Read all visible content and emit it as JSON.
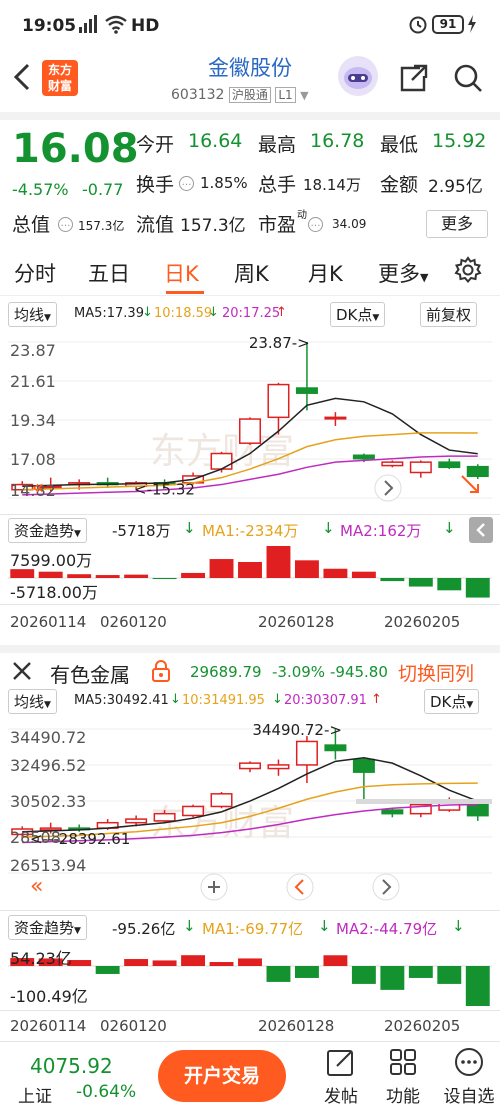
{
  "status": {
    "time": "19:05",
    "hd": "HD",
    "battery": "91"
  },
  "header": {
    "logo_line1": "东方",
    "logo_line2": "财富",
    "stock_name": "金徽股份",
    "stock_code": "603132",
    "tag1": "沪股通",
    "tag2": "L1"
  },
  "quote": {
    "price": "16.08",
    "change_pct": "-4.57%",
    "change": "-0.77",
    "open_label": "今开",
    "open": "16.64",
    "high_label": "最高",
    "high": "16.78",
    "low_label": "最低",
    "low": "15.92",
    "turnover_label": "换手",
    "turnover": "1.85%",
    "volume_label": "总手",
    "volume": "18.14万",
    "amount_label": "金额",
    "amount": "2.95亿",
    "mcap_label": "总值",
    "mcap": "157.3亿",
    "float_label": "流值",
    "float": "157.3亿",
    "pe_label": "市盈",
    "pe_sup": "动",
    "pe": "34.09",
    "more": "更多"
  },
  "tabs": {
    "t1": "分时",
    "t2": "五日",
    "t3": "日K",
    "t4": "周K",
    "t5": "月K",
    "t6": "更多"
  },
  "stock_chart": {
    "ma_select": "均线",
    "ma5": "MA5:17.39",
    "ma10": "10:18.59",
    "ma20": "20:17.25",
    "dk": "DK点",
    "fq": "前复权",
    "y_labels": [
      "23.87",
      "21.61",
      "19.34",
      "17.08",
      "14.82"
    ],
    "max_label": "23.87->",
    "min_label": "<-15.32",
    "fund_label": "资金趋势",
    "fund_value": "-5718万",
    "fund_ma1": "MA1:-2334万",
    "fund_ma2": "MA2:162万",
    "fund_top": "7599.00万",
    "fund_bottom": "-5718.00万",
    "dates": [
      "20260114",
      "0260120",
      "20260128",
      "20260205"
    ]
  },
  "sector": {
    "name": "有色金属",
    "value": "29689.79",
    "pct": "-3.09%",
    "chg": "-945.80",
    "switch": "切换同列",
    "ma_select": "均线",
    "ma5": "MA5:30492.41",
    "ma10": "10:31491.95",
    "ma20": "20:30307.91",
    "dk": "DK点",
    "y_labels": [
      "34490.72",
      "32496.52",
      "30502.33",
      "28508.",
      "26513.94"
    ],
    "max_label": "34490.72->",
    "min_label": "<---28392.61",
    "fund_label": "资金趋势",
    "fund_value": "-95.26亿",
    "fund_ma1": "MA1:-69.77亿",
    "fund_ma2": "MA2:-44.79亿",
    "fund_top": "54.23亿",
    "fund_bottom": "-100.49亿",
    "dates": [
      "20260114",
      "0260120",
      "20260128",
      "20260205"
    ]
  },
  "bottom": {
    "index_value": "4075.92",
    "index_name": "上证",
    "index_pct": "-0.64%",
    "trade": "开户交易",
    "post": "发帖",
    "func": "功能",
    "self": "设自选"
  },
  "colors": {
    "up": "#e02020",
    "down": "#13922f",
    "accent": "#ff5a1f",
    "link": "#2b68c2"
  },
  "chart_data": [
    {
      "type": "candlestick",
      "title": "金徽股份 日K",
      "ylim": [
        14.82,
        23.87
      ],
      "candles": [
        {
          "open": 15.3,
          "close": 15.6,
          "high": 15.8,
          "low": 15.1
        },
        {
          "open": 15.5,
          "close": 15.5,
          "high": 16.0,
          "low": 15.2
        },
        {
          "open": 15.6,
          "close": 15.7,
          "high": 15.9,
          "low": 15.3
        },
        {
          "open": 15.7,
          "close": 15.6,
          "high": 16.0,
          "low": 15.4
        },
        {
          "open": 15.5,
          "close": 15.7,
          "high": 15.8,
          "low": 15.3
        },
        {
          "open": 15.7,
          "close": 15.6,
          "high": 15.9,
          "low": 15.4
        },
        {
          "open": 15.7,
          "close": 16.1,
          "high": 16.3,
          "low": 15.6
        },
        {
          "open": 16.5,
          "close": 17.4,
          "high": 17.5,
          "low": 16.3
        },
        {
          "open": 18.0,
          "close": 19.4,
          "high": 19.5,
          "low": 17.9
        },
        {
          "open": 19.5,
          "close": 21.4,
          "high": 21.5,
          "low": 18.5
        },
        {
          "open": 21.2,
          "close": 20.9,
          "high": 23.87,
          "low": 19.9
        },
        {
          "open": 19.5,
          "close": 19.5,
          "high": 19.8,
          "low": 19.0
        },
        {
          "open": 17.3,
          "close": 17.1,
          "high": 17.4,
          "low": 16.9
        },
        {
          "open": 16.7,
          "close": 16.9,
          "high": 17.0,
          "low": 16.6
        },
        {
          "open": 16.3,
          "close": 16.9,
          "high": 17.0,
          "low": 16.0
        },
        {
          "open": 16.9,
          "close": 16.6,
          "high": 17.1,
          "low": 16.5
        },
        {
          "open": 16.64,
          "close": 16.08,
          "high": 16.78,
          "low": 15.92
        }
      ],
      "ma5": [
        15.5,
        15.55,
        15.6,
        15.62,
        15.65,
        15.7,
        15.9,
        16.5,
        17.4,
        18.7,
        20.2,
        20.6,
        20.4,
        19.7,
        18.5,
        17.6,
        17.39
      ],
      "ma10": [
        15.3,
        15.35,
        15.4,
        15.45,
        15.5,
        15.55,
        15.7,
        16.0,
        16.5,
        17.1,
        17.8,
        18.2,
        18.4,
        18.5,
        18.6,
        18.6,
        18.59
      ],
      "ma20": [
        15.0,
        15.05,
        15.1,
        15.15,
        15.2,
        15.3,
        15.4,
        15.6,
        15.9,
        16.2,
        16.6,
        16.9,
        17.0,
        17.1,
        17.2,
        17.25,
        17.25
      ],
      "fund_flow": [
        2100,
        1500,
        900,
        700,
        800,
        -300,
        1200,
        4500,
        3800,
        7599,
        4200,
        2200,
        1500,
        -900,
        -2500,
        -3600,
        -5718
      ]
    },
    {
      "type": "candlestick",
      "title": "有色金属 日K",
      "ylim": [
        26513.94,
        34490.72
      ],
      "candles": [
        {
          "open": 28650,
          "close": 28950,
          "high": 29100,
          "low": 28392.61
        },
        {
          "open": 28900,
          "close": 29000,
          "high": 29300,
          "low": 28700
        },
        {
          "open": 29000,
          "close": 28950,
          "high": 29200,
          "low": 28800
        },
        {
          "open": 29000,
          "close": 29300,
          "high": 29500,
          "low": 28900
        },
        {
          "open": 29300,
          "close": 29500,
          "high": 29700,
          "low": 29100
        },
        {
          "open": 29400,
          "close": 29800,
          "high": 30000,
          "low": 29300
        },
        {
          "open": 29700,
          "close": 30200,
          "high": 30300,
          "low": 29600
        },
        {
          "open": 30200,
          "close": 30900,
          "high": 31000,
          "low": 30100
        },
        {
          "open": 32300,
          "close": 32600,
          "high": 32700,
          "low": 32100
        },
        {
          "open": 32300,
          "close": 32500,
          "high": 32800,
          "low": 31900
        },
        {
          "open": 32500,
          "close": 33800,
          "high": 34100,
          "low": 31500
        },
        {
          "open": 33600,
          "close": 33300,
          "high": 34490.72,
          "low": 32800
        },
        {
          "open": 32800,
          "close": 32100,
          "high": 32900,
          "low": 30600
        },
        {
          "open": 30000,
          "close": 29800,
          "high": 30100,
          "low": 29600
        },
        {
          "open": 29800,
          "close": 30300,
          "high": 30500,
          "low": 29600
        },
        {
          "open": 30000,
          "close": 30500,
          "high": 30700,
          "low": 29900
        },
        {
          "open": 30300,
          "close": 29690,
          "high": 30350,
          "low": 29400
        }
      ],
      "ma5": [
        28800,
        28850,
        28900,
        29000,
        29150,
        29300,
        29550,
        29900,
        30500,
        31200,
        32000,
        32700,
        32900,
        32600,
        31900,
        31100,
        30492.41
      ],
      "ma10": [
        28500,
        28550,
        28600,
        28700,
        28800,
        28950,
        29100,
        29300,
        29650,
        30100,
        30600,
        31000,
        31300,
        31400,
        31450,
        31480,
        31491.95
      ],
      "ma20": [
        28200,
        28250,
        28300,
        28350,
        28420,
        28500,
        28600,
        28750,
        28950,
        29200,
        29500,
        29750,
        29950,
        30100,
        30200,
        30280,
        30307.91
      ],
      "fund_flow": [
        40,
        38,
        30,
        -20,
        35,
        28,
        54.23,
        20,
        38,
        -40,
        -30,
        54,
        -45,
        -60,
        -30,
        -45,
        -100.49
      ]
    }
  ]
}
